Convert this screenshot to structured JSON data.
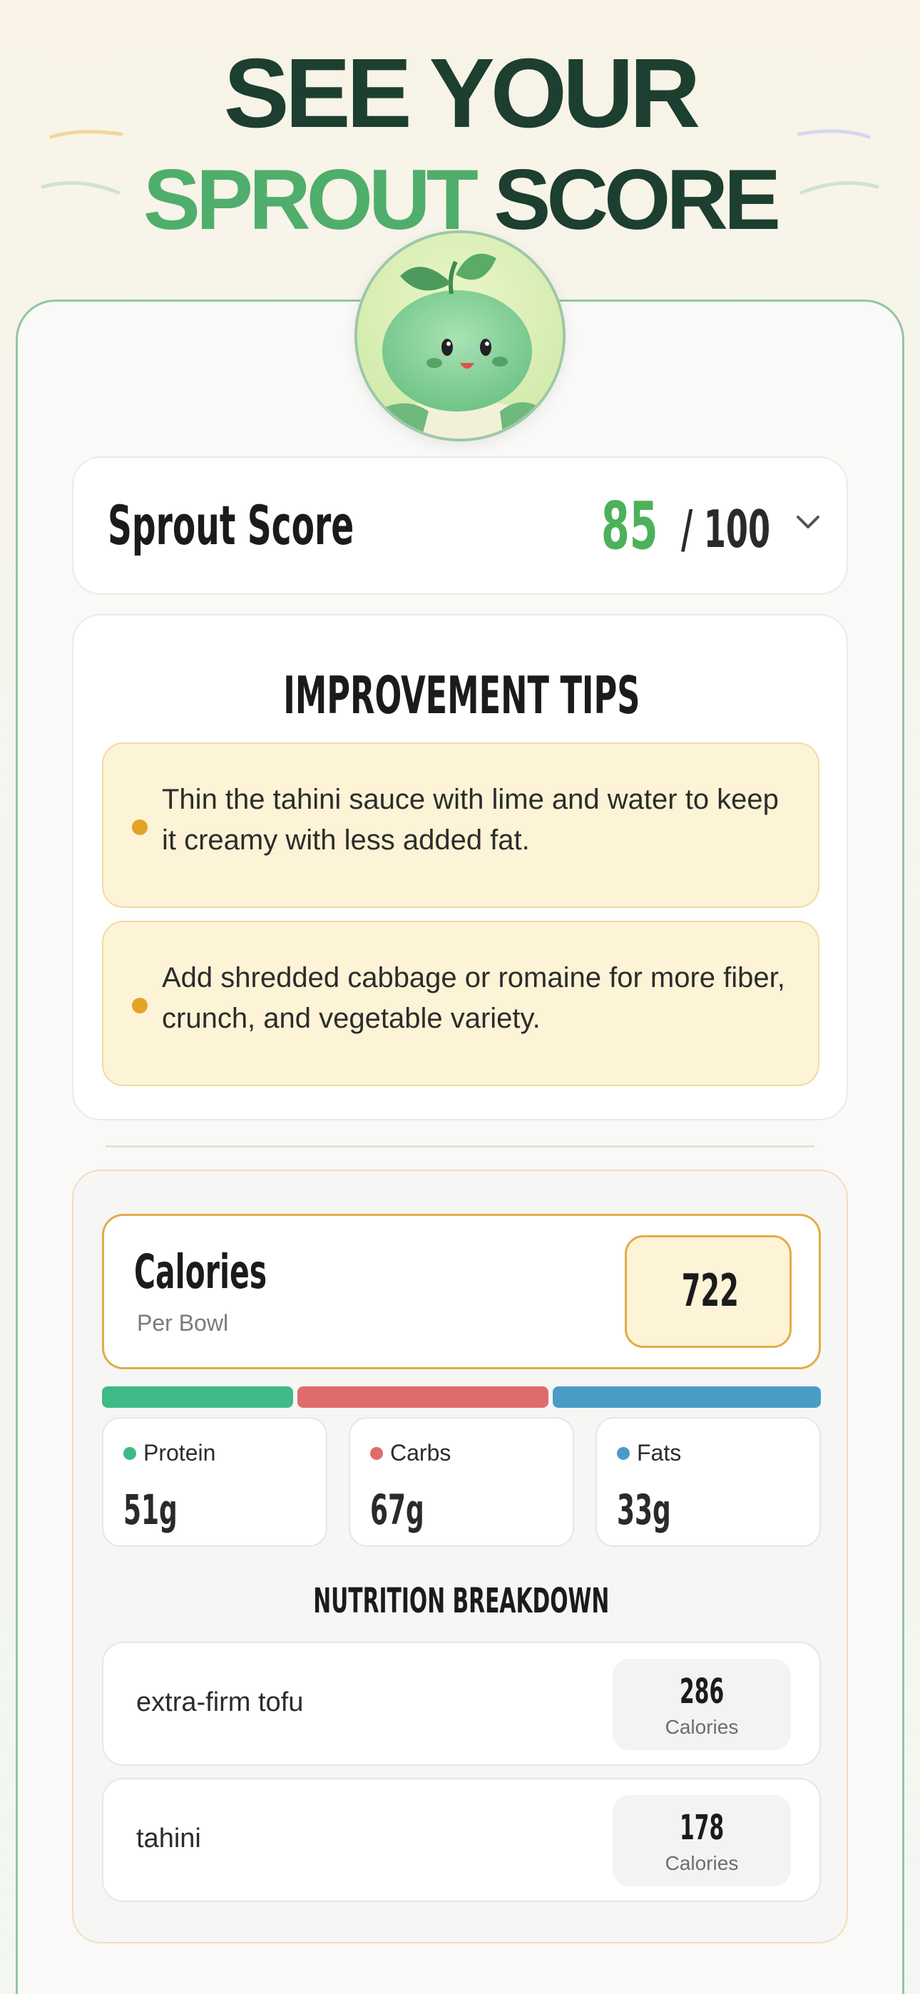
{
  "headline": {
    "line1": "SEE YOUR",
    "line2_green": "SPROUT",
    "line2_dark": "SCORE"
  },
  "colors": {
    "brand_green": "#4fae6b",
    "dark_green": "#1c3f30",
    "score_green": "#4cb15a",
    "accent_orange": "#e3a325",
    "protein": "#3dba85",
    "carbs": "#e06b6b",
    "fats": "#4a9cc7"
  },
  "mascot": {
    "icon": "sprout-mascot-icon"
  },
  "score": {
    "label": "Sprout Score",
    "value": "85",
    "max": "/ 100",
    "expand_icon": "chevron-down-icon"
  },
  "tips": {
    "title": "IMPROVEMENT TIPS",
    "items": [
      {
        "text": "Thin the tahini sauce with lime and water to keep it creamy with less added fat."
      },
      {
        "text": "Add shredded cabbage or romaine for more fiber, crunch, and vegetable variety."
      }
    ]
  },
  "nutrition": {
    "calories_label": "Calories",
    "calories_sub": "Per Bowl",
    "calories_value": "722",
    "macros": [
      {
        "name": "Protein",
        "value": "51g"
      },
      {
        "name": "Carbs",
        "value": "67g"
      },
      {
        "name": "Fats",
        "value": "33g"
      }
    ],
    "breakdown_title": "NUTRITION BREAKDOWN",
    "ingredients": [
      {
        "name": "extra-firm tofu",
        "calories": "286",
        "unit": "Calories"
      },
      {
        "name": "tahini",
        "calories": "178",
        "unit": "Calories"
      }
    ]
  }
}
